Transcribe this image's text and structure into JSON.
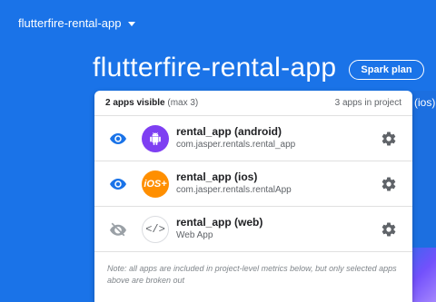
{
  "topbar": {
    "project_selector": "flutterfire-rental-app"
  },
  "header": {
    "title": "flutterfire-rental-app",
    "plan_label": "Spark plan"
  },
  "side_label": "(ios)",
  "card": {
    "visible_label": "2 apps visible",
    "visible_max": " (max 3)",
    "project_count": "3 apps in project",
    "apps": [
      {
        "name": "rental_app (android)",
        "id": "com.jasper.rentals.rental_app",
        "icon": "android-icon",
        "visible": true
      },
      {
        "name": "rental_app (ios)",
        "id": "com.jasper.rentals.rentalApp",
        "icon": "ios-icon",
        "icon_text": "iOS+",
        "visible": true
      },
      {
        "name": "rental_app (web)",
        "id": "Web App",
        "icon": "web-code-icon",
        "icon_text": "</>",
        "visible": false
      }
    ],
    "note": "Note: all apps are included in project-level metrics below, but only selected apps above are broken out"
  },
  "colors": {
    "background": "#1a73e8",
    "eye_active": "#1a73e8",
    "eye_inactive": "#9aa0a6",
    "gear": "#5f6368",
    "android": "#7e3ff2",
    "ios": "#ff8f00"
  }
}
